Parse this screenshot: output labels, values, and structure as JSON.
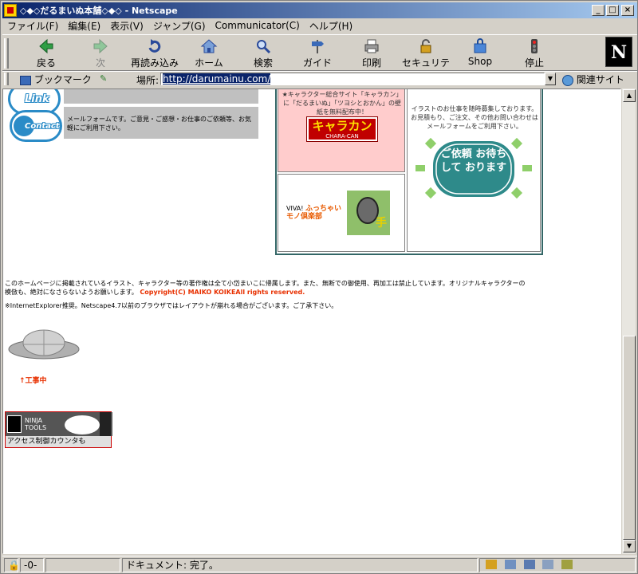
{
  "window": {
    "title": "◇◆◇だるまいぬ本舗◇◆◇ - Netscape",
    "controls": {
      "minimize": "_",
      "maximize": "□",
      "close": "×"
    }
  },
  "menu": [
    "ファイル(F)",
    "編集(E)",
    "表示(V)",
    "ジャンプ(G)",
    "Communicator(C)",
    "ヘルプ(H)"
  ],
  "toolbar": {
    "back": "戻る",
    "forward": "次",
    "reload": "再読み込み",
    "home": "ホーム",
    "search": "検索",
    "guide": "ガイド",
    "print": "印刷",
    "security": "セキュリティ",
    "shop": "Shop",
    "stop": "停止",
    "logo": "N"
  },
  "location": {
    "bookmark": "ブックマーク",
    "label": "場所:",
    "url": "http://darumainu.com/",
    "related": "関連サイト"
  },
  "page": {
    "link_desc": "",
    "contact_label": "Contact",
    "link_label": "Link",
    "contact_desc": "メールフォームです。ご意見・ご感想・お仕事のご依頼等、お気軽にご利用下さい。",
    "chara_desc": "★キャラクター総合サイト「キャラカン」に「だるまいぬ」「ツヨシとおかん」の壁紙を無料配布中！",
    "chara_logo": "キャラカン",
    "chara_sub": "CHARA-CAN",
    "viva_prefix": "VIVA!",
    "viva_title": "ふっちゃい モノ倶楽部",
    "work_desc": "イラストのお仕事を随時募集しております。お見積もり、ご注文、その他お問い合わせはメールフォームをご利用下さい。",
    "work_badge": "ご依頼 お待ちして おります",
    "copyright_text": "このホームページに掲載されているイラスト、キャラクター等の著作権は全て小岱まいこに帰属します。また、無断での御使用、再加工は禁止しています。オリジナルキャラクターの模倣も、絶対になさらないようお願いします。",
    "copyright": "Copyright(C) MAIKO KOIKEAll rights reserved.",
    "browser_note": "※InternetExplorer推奨。Netscape4.7以前のブラウザではレイアウトが崩れる場合がございます。ご了承下さい。",
    "construction": "↑工事中",
    "ninja_brand": "NINJA TOOLS",
    "ninja_text": "アクセス制御カウンタも"
  },
  "status": {
    "text": "ドキュメント: 完了。"
  }
}
